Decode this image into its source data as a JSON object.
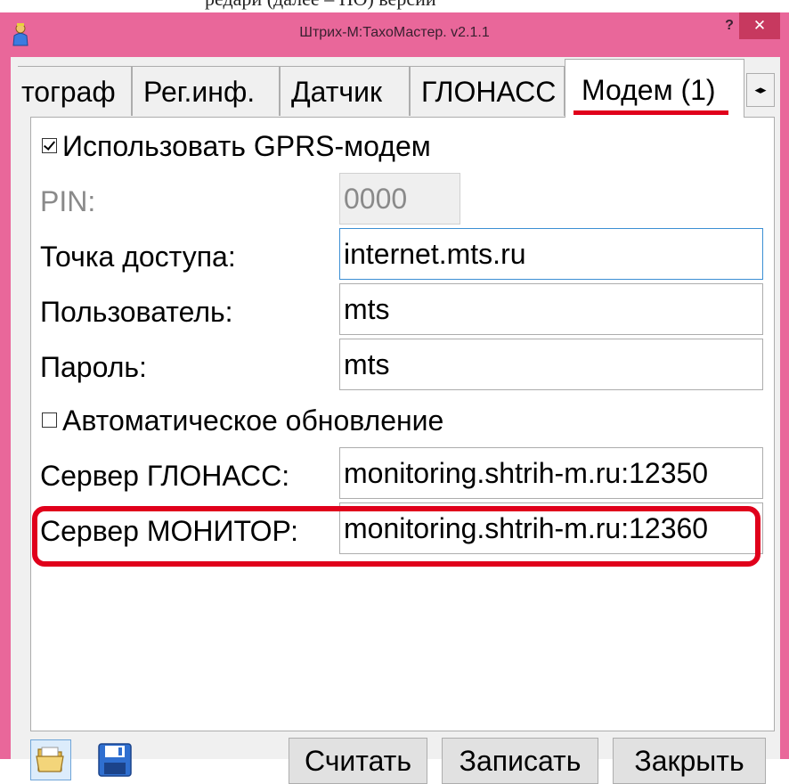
{
  "caption": {
    "text": "редари (далее – ПО) версии"
  },
  "window": {
    "title": "Штрих-М:ТахоМастер. v2.1.1",
    "help_label": "?",
    "close_label": "✕",
    "app_icon": "person-icon"
  },
  "tabs": [
    {
      "label": "тограф"
    },
    {
      "label": "Рег.инф."
    },
    {
      "label": "Датчик"
    },
    {
      "label": "ГЛОНАСС"
    },
    {
      "label": "Модем (1)",
      "active": true
    }
  ],
  "tab_scroller": {
    "left": "◂",
    "right": "▸"
  },
  "form": {
    "use_gprs": {
      "label": "Использовать GPRS-модем",
      "checked": true
    },
    "pin": {
      "label": "PIN:",
      "value": "0000",
      "disabled": true
    },
    "apn": {
      "label": "Точка доступа:",
      "value": "internet.mts.ru"
    },
    "user": {
      "label": "Пользователь:",
      "value": "mts"
    },
    "password": {
      "label": "Пароль:",
      "value": "mts"
    },
    "auto_update": {
      "label": "Автоматическое обновление",
      "checked": false
    },
    "glonass_server": {
      "label": "Сервер ГЛОНАСС:",
      "value": "monitoring.shtrih-m.ru:12350"
    },
    "monitor_server": {
      "label": "Сервер МОНИТОР:",
      "value": "monitoring.shtrih-m.ru:12360"
    }
  },
  "footer": {
    "open_icon": "folder-icon",
    "save_icon": "floppy-disk-icon",
    "read_label": "Считать",
    "write_label": "Записать",
    "close_label": "Закрыть"
  },
  "colors": {
    "titlebar": "#e9679a",
    "close_button": "#c7395f",
    "annotation": "#e0001b",
    "focus_border": "#3c8fd4"
  }
}
